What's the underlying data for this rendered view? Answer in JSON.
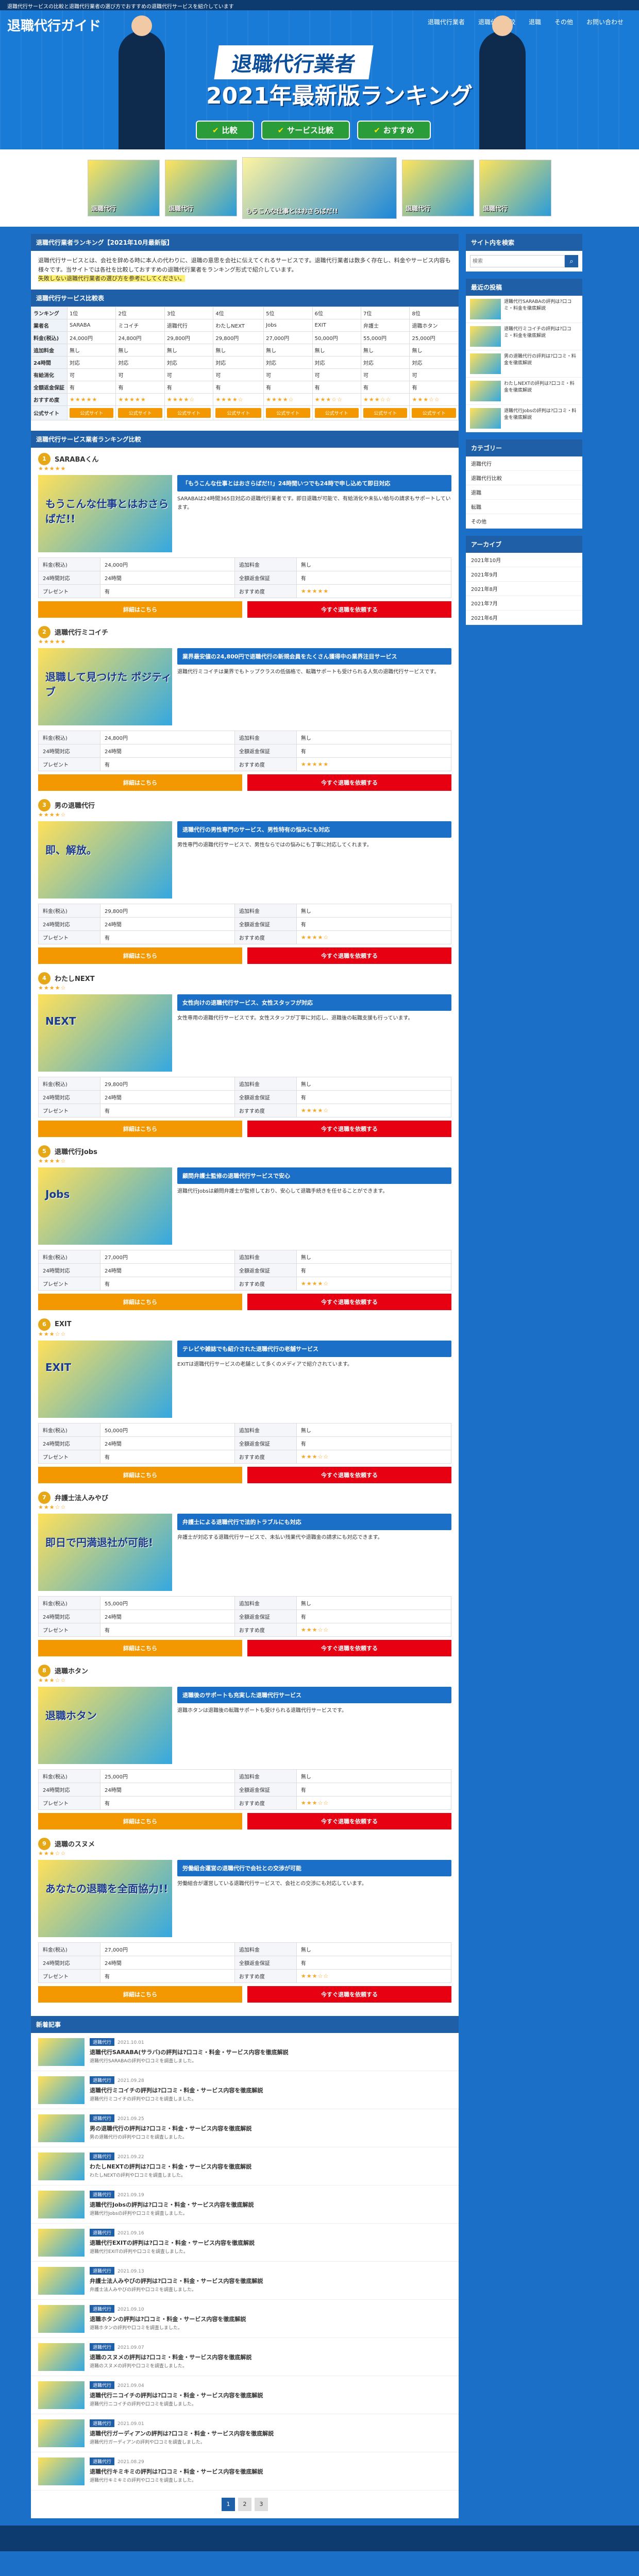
{
  "topbar": {
    "text": "退職代行サービスの比較と退職代行業者の選び方でおすすめの退職代行サービスを紹介しています"
  },
  "site": {
    "logo": "退職代行ガイド",
    "nav": [
      "退職代行業者",
      "退職代行比較",
      "退職",
      "その他",
      "お問い合わせ"
    ]
  },
  "hero": {
    "line1": "退職代行業者",
    "line2": "2021年最新版ランキング",
    "buttons": [
      "比較",
      "サービス比較",
      "おすすめ"
    ]
  },
  "banners": [
    {
      "label": "退職代行"
    },
    {
      "label": "退職代行"
    },
    {
      "label": "もうこんな仕事とはおさらばだ!!"
    },
    {
      "label": "退職代行"
    },
    {
      "label": "退職代行"
    }
  ],
  "intro": {
    "title": "退職代行業者ランキング【2021年10月最新版】",
    "body": "退職代行サービスとは、会社を辞める時に本人の代わりに、退職の意思を会社に伝えてくれるサービスです。退職代行業者は数多く存在し、料金やサービス内容も様々です。当サイトでは各社を比較しておすすめの退職代行業者をランキング形式で紹介しています。",
    "highlight": "失敗しない退職代行業者の選び方を参考にしてください。"
  },
  "compare": {
    "title": "退職代行サービス比較表",
    "rows": [
      {
        "key": "ランキング",
        "cells": [
          "1位",
          "2位",
          "3位",
          "4位",
          "5位",
          "6位",
          "7位",
          "8位"
        ]
      },
      {
        "key": "業者名",
        "cells": [
          "SARABA",
          "ミコイチ",
          "退職代行",
          "わたしNEXT",
          "Jobs",
          "EXIT",
          "弁護士",
          "退職ホタン"
        ]
      },
      {
        "key": "料金(税込)",
        "cells": [
          "24,000円",
          "24,800円",
          "29,800円",
          "29,800円",
          "27,000円",
          "50,000円",
          "55,000円",
          "25,000円"
        ]
      },
      {
        "key": "追加料金",
        "cells": [
          "無し",
          "無し",
          "無し",
          "無し",
          "無し",
          "無し",
          "無し",
          "無し"
        ]
      },
      {
        "key": "24時間",
        "cells": [
          "対応",
          "対応",
          "対応",
          "対応",
          "対応",
          "対応",
          "対応",
          "対応"
        ]
      },
      {
        "key": "有給消化",
        "cells": [
          "可",
          "可",
          "可",
          "可",
          "可",
          "可",
          "可",
          "可"
        ]
      },
      {
        "key": "全額返金保証",
        "cells": [
          "有",
          "有",
          "有",
          "有",
          "有",
          "有",
          "有",
          "有"
        ]
      },
      {
        "key": "おすすめ度",
        "cells": [
          "★★★★★",
          "★★★★★",
          "★★★★☆",
          "★★★★☆",
          "★★★★☆",
          "★★★☆☆",
          "★★★☆☆",
          "★★★☆☆"
        ]
      },
      {
        "key": "公式サイト",
        "cells": [
          "公式サイト",
          "公式サイト",
          "公式サイト",
          "公式サイト",
          "公式サイト",
          "公式サイト",
          "公式サイト",
          "公式サイト"
        ]
      }
    ]
  },
  "ranking": {
    "title": "退職代行サービス業者ランキング比較",
    "items": [
      {
        "rank": "1",
        "name": "SARABAくん",
        "catch": "「もうこんな仕事とはおさらばだ!!」24時間いつでも24時で申し込めて即日対応",
        "img": "もうこんな仕事とはおさらばだ!!",
        "desc": "SARABAは24時間365日対応の退職代行業者です。即日退職が可能で、有給消化や未払い給与の請求もサポートしています。",
        "price": "24,000円",
        "extra": "無し",
        "hours": "24時間",
        "refund": "有",
        "bonus": "有",
        "rating": "★★★★★"
      },
      {
        "rank": "2",
        "name": "退職代行ミコイチ",
        "catch": "業界最安値の24,800円で退職代行の新規会員をたくさん獲得中の業界注目サービス",
        "img": "退職して見つけた ポジティブ",
        "desc": "退職代行ミコイチは業界でもトップクラスの低価格で、転職サポートも受けられる人気の退職代行サービスです。",
        "price": "24,800円",
        "extra": "無し",
        "hours": "24時間",
        "refund": "有",
        "bonus": "有",
        "rating": "★★★★★"
      },
      {
        "rank": "3",
        "name": "男の退職代行",
        "catch": "退職代行の男性専門のサービス、男性特有の悩みにも対応",
        "img": "即、解放。",
        "desc": "男性専門の退職代行サービスで、男性ならではの悩みにも丁寧に対応してくれます。",
        "price": "29,800円",
        "extra": "無し",
        "hours": "24時間",
        "refund": "有",
        "bonus": "有",
        "rating": "★★★★☆"
      },
      {
        "rank": "4",
        "name": "わたしNEXT",
        "catch": "女性向けの退職代行サービス、女性スタッフが対応",
        "img": "NEXT",
        "desc": "女性専用の退職代行サービスです。女性スタッフが丁寧に対応し、退職後の転職支援も行っています。",
        "price": "29,800円",
        "extra": "無し",
        "hours": "24時間",
        "refund": "有",
        "bonus": "有",
        "rating": "★★★★☆"
      },
      {
        "rank": "5",
        "name": "退職代行Jobs",
        "catch": "顧問弁護士監修の退職代行サービスで安心",
        "img": "Jobs",
        "desc": "退職代行Jobsは顧問弁護士が監修しており、安心して退職手続きを任せることができます。",
        "price": "27,000円",
        "extra": "無し",
        "hours": "24時間",
        "refund": "有",
        "bonus": "有",
        "rating": "★★★★☆"
      },
      {
        "rank": "6",
        "name": "EXIT",
        "catch": "テレビや雑誌でも紹介された退職代行の老舗サービス",
        "img": "EXIT",
        "desc": "EXITは退職代行サービスの老舗として多くのメディアで紹介されています。",
        "price": "50,000円",
        "extra": "無し",
        "hours": "24時間",
        "refund": "有",
        "bonus": "有",
        "rating": "★★★☆☆"
      },
      {
        "rank": "7",
        "name": "弁護士法人みやび",
        "catch": "弁護士による退職代行で法的トラブルにも対応",
        "img": "即日で円満退社が可能!",
        "desc": "弁護士が対応する退職代行サービスで、未払い残業代や退職金の請求にも対応できます。",
        "price": "55,000円",
        "extra": "無し",
        "hours": "24時間",
        "refund": "有",
        "bonus": "有",
        "rating": "★★★☆☆"
      },
      {
        "rank": "8",
        "name": "退職ホタン",
        "catch": "退職後のサポートも充実した退職代行サービス",
        "img": "退職ホタン",
        "desc": "退職ホタンは退職後の転職サポートも受けられる退職代行サービスです。",
        "price": "25,000円",
        "extra": "無し",
        "hours": "24時間",
        "refund": "有",
        "bonus": "有",
        "rating": "★★★☆☆"
      },
      {
        "rank": "9",
        "name": "退職のスヌメ",
        "catch": "労働組合運営の退職代行で会社との交渉が可能",
        "img": "あなたの退職を全面協力!!",
        "desc": "労働組合が運営している退職代行サービスで、会社との交渉にも対応しています。",
        "price": "27,000円",
        "extra": "無し",
        "hours": "24時間",
        "refund": "有",
        "bonus": "有",
        "rating": "★★★☆☆"
      }
    ],
    "labels": {
      "price": "料金(税込)",
      "extra": "追加料金",
      "hours": "24時間対応",
      "refund": "全額返金保証",
      "bonus": "プレゼント",
      "rating": "おすすめ度",
      "btn1": "詳細はこちら",
      "btn2": "今すぐ退職を依頼する"
    }
  },
  "news": {
    "title": "新着記事",
    "items": [
      {
        "cat": "退職代行",
        "date": "2021.10.01",
        "title": "退職代行SARABA(サラバ)の評判は?口コミ・料金・サービス内容を徹底解説",
        "ex": "退職代行SARABAの評判や口コミを調査しました。"
      },
      {
        "cat": "退職代行",
        "date": "2021.09.28",
        "title": "退職代行ミコイチの評判は?口コミ・料金・サービス内容を徹底解説",
        "ex": "退職代行ミコイチの評判や口コミを調査しました。"
      },
      {
        "cat": "退職代行",
        "date": "2021.09.25",
        "title": "男の退職代行の評判は?口コミ・料金・サービス内容を徹底解説",
        "ex": "男の退職代行の評判や口コミを調査しました。"
      },
      {
        "cat": "退職代行",
        "date": "2021.09.22",
        "title": "わたしNEXTの評判は?口コミ・料金・サービス内容を徹底解説",
        "ex": "わたしNEXTの評判や口コミを調査しました。"
      },
      {
        "cat": "退職代行",
        "date": "2021.09.19",
        "title": "退職代行Jobsの評判は?口コミ・料金・サービス内容を徹底解説",
        "ex": "退職代行Jobsの評判や口コミを調査しました。"
      },
      {
        "cat": "退職代行",
        "date": "2021.09.16",
        "title": "退職代行EXITの評判は?口コミ・料金・サービス内容を徹底解説",
        "ex": "退職代行EXITの評判や口コミを調査しました。"
      },
      {
        "cat": "退職代行",
        "date": "2021.09.13",
        "title": "弁護士法人みやびの評判は?口コミ・料金・サービス内容を徹底解説",
        "ex": "弁護士法人みやびの評判や口コミを調査しました。"
      },
      {
        "cat": "退職代行",
        "date": "2021.09.10",
        "title": "退職ホタンの評判は?口コミ・料金・サービス内容を徹底解説",
        "ex": "退職ホタンの評判や口コミを調査しました。"
      },
      {
        "cat": "退職代行",
        "date": "2021.09.07",
        "title": "退職のスヌメの評判は?口コミ・料金・サービス内容を徹底解説",
        "ex": "退職のスヌメの評判や口コミを調査しました。"
      },
      {
        "cat": "退職代行",
        "date": "2021.09.04",
        "title": "退職代行ニコイチの評判は?口コミ・料金・サービス内容を徹底解説",
        "ex": "退職代行ニコイチの評判や口コミを調査しました。"
      },
      {
        "cat": "退職代行",
        "date": "2021.09.01",
        "title": "退職代行ガーディアンの評判は?口コミ・料金・サービス内容を徹底解説",
        "ex": "退職代行ガーディアンの評判や口コミを調査しました。"
      },
      {
        "cat": "退職代行",
        "date": "2021.08.29",
        "title": "退職代行キミキミの評判は?口コミ・料金・サービス内容を徹底解説",
        "ex": "退職代行キミキミの評判や口コミを調査しました。"
      }
    ]
  },
  "pager": [
    "1",
    "2",
    "3"
  ],
  "sidebar": {
    "search_title": "サイト内を検索",
    "search_placeholder": "検索",
    "recent_title": "最近の投稿",
    "recent": [
      "退職代行SARABAの評判は?口コミ・料金を徹底解説",
      "退職代行ミコイチの評判は?口コミ・料金を徹底解説",
      "男の退職代行の評判は?口コミ・料金を徹底解説",
      "わたしNEXTの評判は?口コミ・料金を徹底解説",
      "退職代行Jobsの評判は?口コミ・料金を徹底解説"
    ],
    "cat_title": "カテゴリー",
    "cats": [
      "退職代行",
      "退職代行比較",
      "退職",
      "転職",
      "その他"
    ],
    "archive_title": "アーカイブ",
    "archives": [
      "2021年10月",
      "2021年9月",
      "2021年8月",
      "2021年7月",
      "2021年6月"
    ]
  }
}
